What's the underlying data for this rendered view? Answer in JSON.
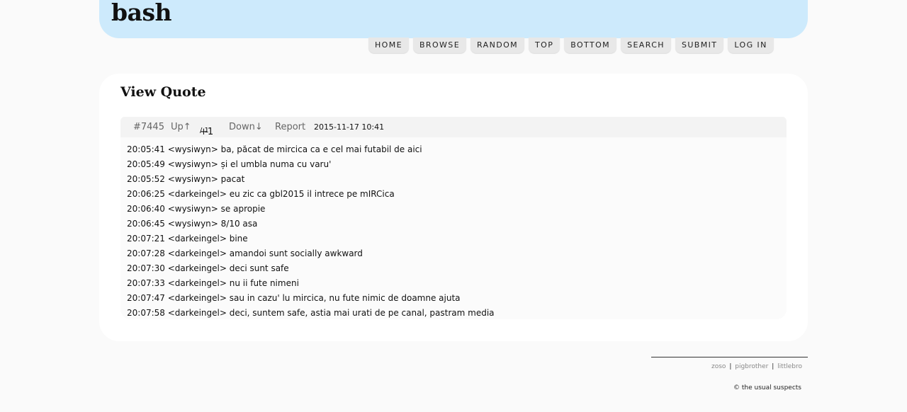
{
  "site": {
    "logo": "bash"
  },
  "nav": {
    "items": [
      {
        "label": "HOME"
      },
      {
        "label": "BROWSE"
      },
      {
        "label": "RANDOM"
      },
      {
        "label": "TOP"
      },
      {
        "label": "BOTTOM"
      },
      {
        "label": "SEARCH"
      },
      {
        "label": "SUBMIT"
      },
      {
        "label": "LOG IN"
      }
    ]
  },
  "page": {
    "title": "View Quote"
  },
  "quote": {
    "id": "#7445",
    "up_label": "Up↑",
    "score": "+1",
    "votes": "/ 1",
    "down_label": "Down↓",
    "report_label": "Report",
    "date": "2015-11-17 10:41",
    "lines": [
      "20:05:41 <wysiwyn> ba, păcat de mircica ca e cel mai futabil de aici",
      "20:05:49 <wysiwyn> și el umbla numa cu varu'",
      "20:05:52 <wysiwyn> pacat",
      "20:06:25 <darkeingel> eu zic ca gbl2015 il intrece pe mIRCica",
      "20:06:40 <wysiwyn> se apropie",
      "20:06:45 <wysiwyn> 8/10 asa",
      "20:07:21 <darkeingel> bine",
      "20:07:28 <darkeingel> amandoi sunt socially awkward",
      "20:07:30 <darkeingel> deci sunt safe",
      "20:07:33 <darkeingel> nu ii fute nimeni",
      "20:07:47 <darkeingel> sau in cazu' lu mircica, nu fute nimic de doamne ajuta",
      "20:07:58 <darkeingel> deci, suntem safe, astia mai urati de pe canal, pastram media"
    ]
  },
  "footer": {
    "links": [
      {
        "label": "zoso"
      },
      {
        "label": "pigbrother"
      },
      {
        "label": "littlebro"
      }
    ],
    "separator": "|",
    "copyright": "© the usual suspects"
  }
}
